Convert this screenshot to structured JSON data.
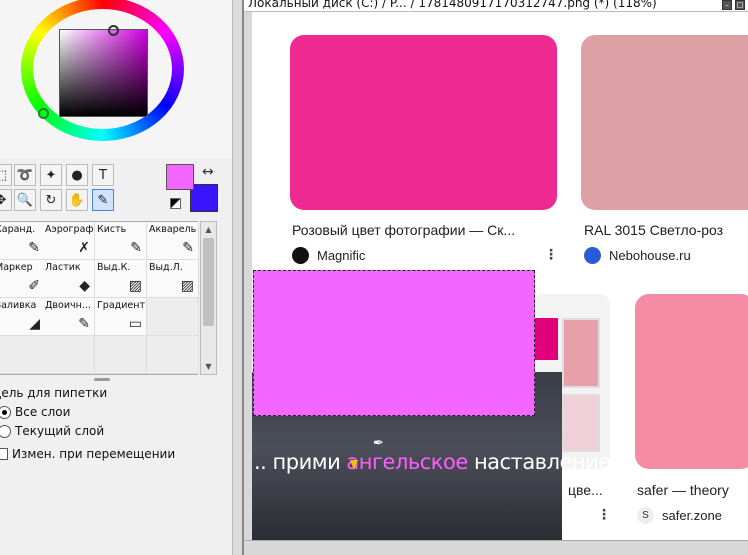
{
  "titlebar": {
    "text": "Локальный диск (C:) / P...  / 1781480917170312747.png (*) (118%)"
  },
  "colors": {
    "foreground": "#f366ff",
    "background": "#3a14ff",
    "accent": "#4a84d8"
  },
  "tools": [
    {
      "name": "rect-select-icon",
      "glyph": "⬚"
    },
    {
      "name": "lasso-icon",
      "glyph": "➰"
    },
    {
      "name": "magic-wand-icon",
      "glyph": "✦"
    },
    {
      "name": "shape-icon",
      "glyph": "●"
    },
    {
      "name": "text-icon",
      "glyph": "T"
    },
    {
      "name": "move-icon",
      "glyph": "✥"
    },
    {
      "name": "zoom-icon",
      "glyph": "🔍"
    },
    {
      "name": "rotate-icon",
      "glyph": "↻"
    },
    {
      "name": "hand-icon",
      "glyph": "✋"
    },
    {
      "name": "eyedropper-icon",
      "glyph": "✎"
    }
  ],
  "brushes": [
    {
      "label": "Каранд.",
      "icon": "pencil-icon",
      "glyph": "✎"
    },
    {
      "label": "Аэрограф",
      "icon": "airbrush-icon",
      "glyph": "✗"
    },
    {
      "label": "Кисть",
      "icon": "brush-icon",
      "glyph": "✎"
    },
    {
      "label": "Акварель",
      "icon": "watercolor-icon",
      "glyph": "✎"
    },
    {
      "label": "Маркер",
      "icon": "marker-icon",
      "glyph": "✐"
    },
    {
      "label": "Ластик",
      "icon": "eraser-icon",
      "glyph": "◆"
    },
    {
      "label": "Выд.К.",
      "icon": "select-pen-icon",
      "glyph": "▨"
    },
    {
      "label": "Выд.Л.",
      "icon": "deselect-pen-icon",
      "glyph": "▨"
    },
    {
      "label": "Заливка",
      "icon": "fill-icon",
      "glyph": "◢"
    },
    {
      "label": "Двоичн...",
      "icon": "binary-pen-icon",
      "glyph": "✎"
    },
    {
      "label": "Градиент",
      "icon": "gradient-icon",
      "glyph": "▭"
    }
  ],
  "picker": {
    "title": "Цель для пипетки",
    "opt_all": "Все слои",
    "opt_current": "Текущий слой",
    "opt_move": "Измен. при перемещении",
    "selected": "Все слои"
  },
  "cards": [
    {
      "title": "Розовый цвет фотографии — Ск...",
      "source": "Magnific",
      "color": "#ee2a90"
    },
    {
      "title": "RAL 3015 Светло-роз",
      "source": "Nebohouse.ru",
      "color": "#dda0a4"
    },
    {
      "title": "",
      "source": "",
      "color": ""
    },
    {
      "title": "safer — theory",
      "source": "safer.zone",
      "color": "#f58ca5"
    }
  ],
  "video": {
    "pre": ".. прими ",
    "highlight": "ангельское",
    "post": " наставление."
  },
  "mid_card": {
    "title": "цве...",
    "kebab": "⋮"
  }
}
